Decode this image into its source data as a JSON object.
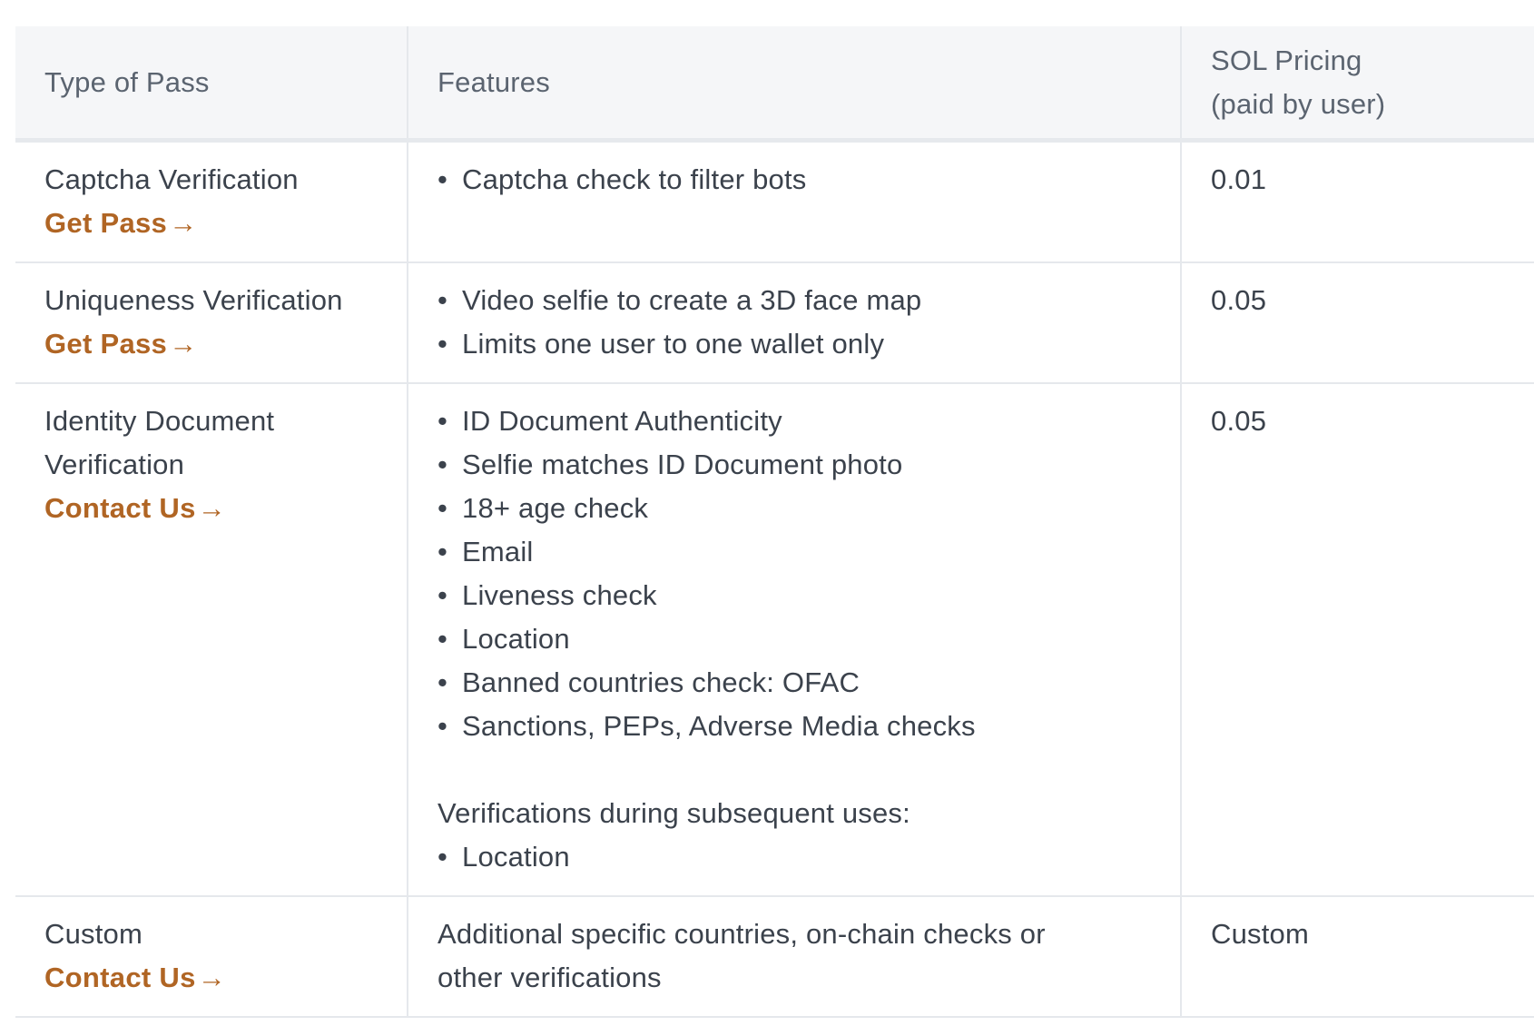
{
  "table": {
    "headers": {
      "type": "Type of Pass",
      "features": "Features",
      "pricing_line1": "SOL Pricing",
      "pricing_line2": "(paid by user)"
    },
    "rows": [
      {
        "type_lines": [
          "Captcha Verification"
        ],
        "action": "Get Pass",
        "arrow": "→",
        "features": [
          "Captcha check to filter bots"
        ],
        "price": "0.01"
      },
      {
        "type_lines": [
          "Uniqueness Verification"
        ],
        "action": "Get Pass",
        "arrow": "→",
        "features": [
          "Video selfie to create a 3D face map",
          "Limits one user to one wallet only"
        ],
        "price": "0.05"
      },
      {
        "type_lines": [
          "Identity Document",
          "Verification"
        ],
        "action": "Contact Us",
        "arrow": "→",
        "features": [
          "ID Document Authenticity",
          "Selfie matches ID Document photo",
          "18+ age check",
          "Email",
          "Liveness check",
          "Location",
          "Banned countries check: OFAC",
          "Sanctions, PEPs, Adverse Media checks"
        ],
        "subsequent_heading": "Verifications during subsequent uses:",
        "subsequent_features": [
          "Location"
        ],
        "price": "0.05"
      },
      {
        "type_lines": [
          "Custom"
        ],
        "action": "Contact Us",
        "arrow": "→",
        "features_text_lines": [
          "Additional specific countries, on-chain checks or",
          "other verifications"
        ],
        "price": "Custom"
      }
    ]
  },
  "colors": {
    "link": "#b06524",
    "header_bg": "#f5f6f8",
    "text": "#3b424c",
    "border": "#e5e8ec"
  }
}
